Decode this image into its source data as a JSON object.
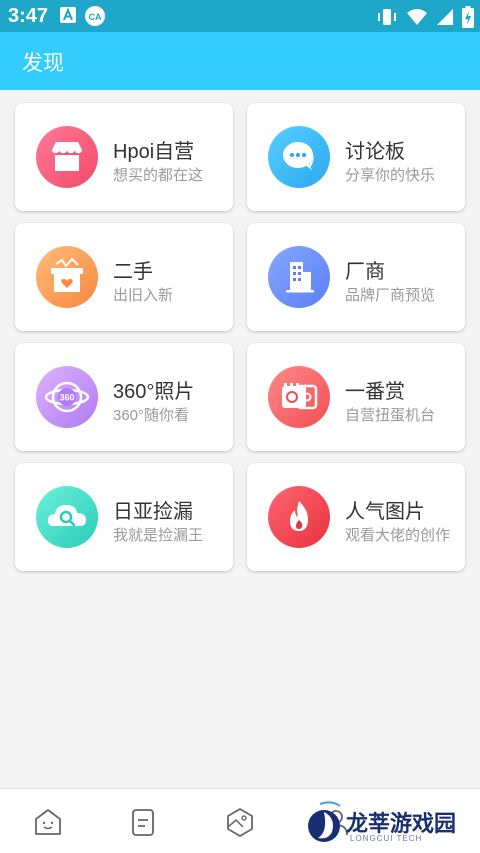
{
  "status_bar": {
    "time": "3:47"
  },
  "app_bar": {
    "title": "发现"
  },
  "cards": [
    {
      "title": "Hpoi自营",
      "subtitle": "想买的都在这",
      "icon": "store-icon",
      "colors": [
        "#ff6b8b",
        "#f2496b"
      ]
    },
    {
      "title": "讨论板",
      "subtitle": "分享你的快乐",
      "icon": "chat-bubble-icon",
      "colors": [
        "#4fc8ff",
        "#2aa7f0"
      ]
    },
    {
      "title": "二手",
      "subtitle": "出旧入新",
      "icon": "box-heart-icon",
      "colors": [
        "#ffb36b",
        "#f9883f"
      ]
    },
    {
      "title": "厂商",
      "subtitle": "品牌厂商预览",
      "icon": "building-icon",
      "colors": [
        "#7ba0ff",
        "#5a7ef5"
      ]
    },
    {
      "title": "360°照片",
      "subtitle": "360°随你看",
      "icon": "360-globe-icon",
      "colors": [
        "#d4a8ff",
        "#b07af0"
      ]
    },
    {
      "title": "一番赏",
      "subtitle": "自营扭蛋机台",
      "icon": "ticket-icon",
      "colors": [
        "#ff7d7d",
        "#f24d52"
      ]
    },
    {
      "title": "日亚捡漏",
      "subtitle": "我就是捡漏王",
      "icon": "cloud-search-icon",
      "colors": [
        "#5eead4",
        "#27cdb7"
      ]
    },
    {
      "title": "人气图片",
      "subtitle": "观看大佬的创作",
      "icon": "fire-icon",
      "colors": [
        "#ff5a67",
        "#e8323f"
      ]
    }
  ],
  "bottom_nav": [
    "home-icon",
    "news-icon",
    "box-3d-icon",
    "profile-icon"
  ],
  "watermark": {
    "text": "龙莘游戏园",
    "sub": "LONGCUI TECH"
  }
}
